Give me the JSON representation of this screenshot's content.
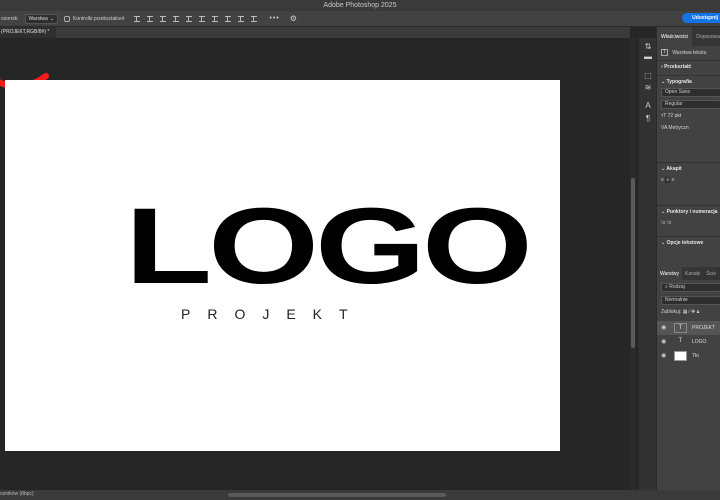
{
  "window": {
    "title": "Adobe Photoshop 2025"
  },
  "options_bar": {
    "sample_label": "ozornik:",
    "sample_value": "Warstwa",
    "checkbox_label": "Kontrolki przekształceń",
    "more": "•••",
    "gear": "⚙",
    "share_label": "Udostępnij"
  },
  "document_tab": {
    "label": "(PROJEKT,RGB/8#) *"
  },
  "canvas": {
    "logo_text": "LOGO",
    "sub_text": "PROJEKT",
    "logo_color": "#000000",
    "accent_arc_color": "#ff1a1a"
  },
  "status_bar": {
    "text": "ozników (8bpc)"
  },
  "tools": [
    {
      "icon": "⇅",
      "name": "adjust-tool-icon"
    },
    {
      "icon": "▬",
      "name": "comment-tool-icon"
    },
    {
      "icon": "⬚",
      "name": "brush-tool-icon"
    },
    {
      "icon": "≋",
      "name": "sliders-tool-icon"
    },
    {
      "icon": "A",
      "name": "character-tool-icon"
    },
    {
      "icon": "¶",
      "name": "paragraph-tool-icon"
    }
  ],
  "properties": {
    "tabs": [
      "Właściwości",
      "Dopasowania"
    ],
    "layer_type": "Warstwa tekstu",
    "transform": "Przekształć",
    "typography": "Typografia",
    "font_family": "Open Sans",
    "font_style": "Regular",
    "font_size": "72 pkt",
    "kerning": "Metryczn",
    "paragraph": "Akapit",
    "bullets": "Punktory i numeracja",
    "text_options": "Opcje tekstowe"
  },
  "layers_panel": {
    "tabs": [
      "Warstwy",
      "Kanały",
      "Ście"
    ],
    "filter_value": "Rodzaj",
    "blend_mode": "Normalnie",
    "lock_label": "Zablokuj:",
    "layers": [
      {
        "name": "PROJEKT",
        "selected": true,
        "thumb": "T"
      },
      {
        "name": "LOGO",
        "selected": false,
        "thumb": "T"
      },
      {
        "name": "Tło",
        "selected": false,
        "thumb": ""
      }
    ]
  }
}
